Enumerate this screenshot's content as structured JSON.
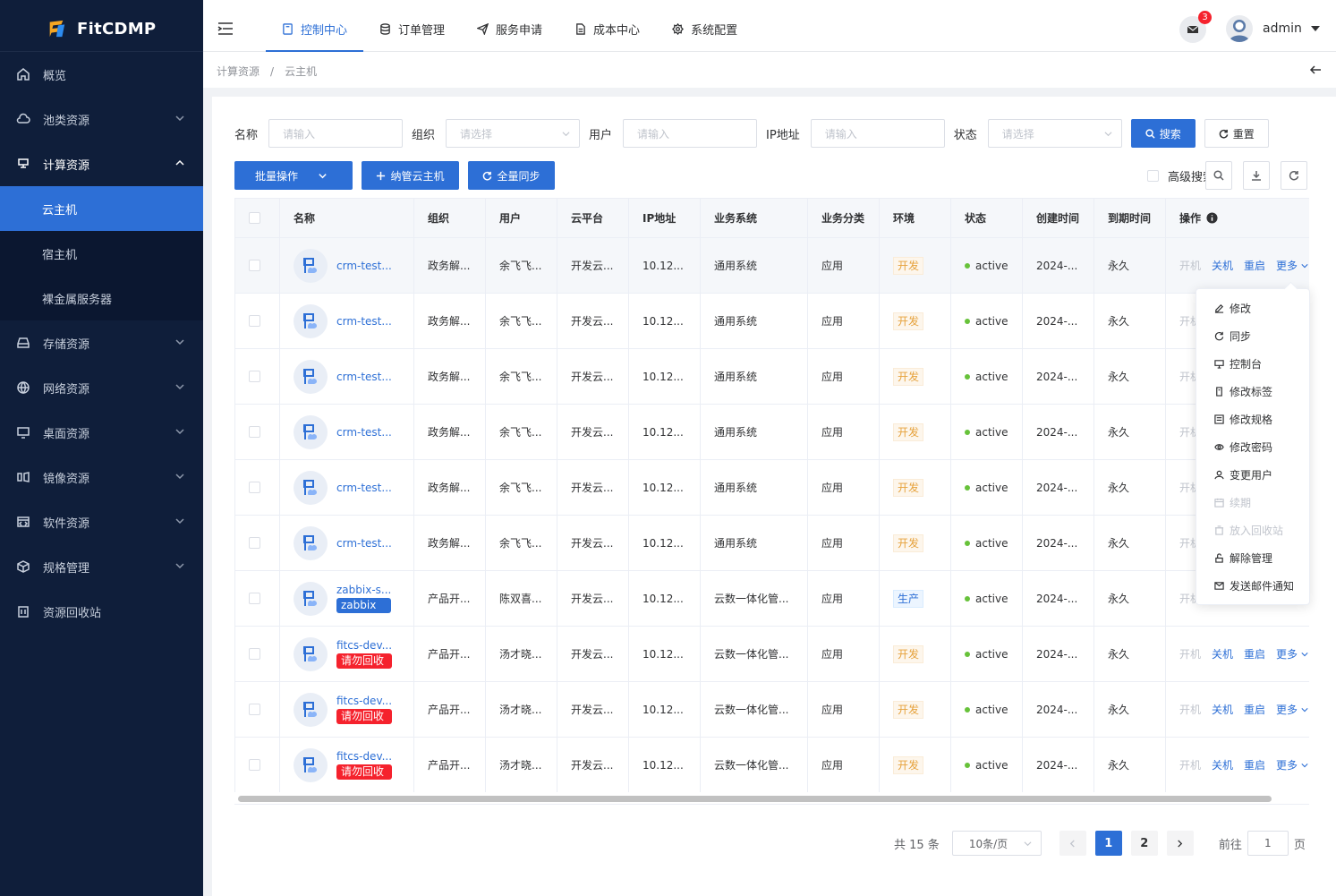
{
  "app": {
    "name": "FitCDMP"
  },
  "sidebar": {
    "items": [
      {
        "label": "概览",
        "icon": "home-icon"
      },
      {
        "label": "池类资源",
        "icon": "cloud-icon"
      },
      {
        "label": "计算资源",
        "icon": "compute-icon"
      },
      {
        "label": "存储资源",
        "icon": "storage-icon"
      },
      {
        "label": "网络资源",
        "icon": "globe-icon"
      },
      {
        "label": "桌面资源",
        "icon": "desktop-icon"
      },
      {
        "label": "镜像资源",
        "icon": "image-icon"
      },
      {
        "label": "软件资源",
        "icon": "software-icon"
      },
      {
        "label": "规格管理",
        "icon": "cube-icon"
      },
      {
        "label": "资源回收站",
        "icon": "trash-icon"
      }
    ],
    "sub_items": [
      "云主机",
      "宿主机",
      "裸金属服务器"
    ]
  },
  "topbar": {
    "tabs": [
      "控制中心",
      "订单管理",
      "服务申请",
      "成本中心",
      "系统配置"
    ],
    "badge_count": "3",
    "user": "admin"
  },
  "breadcrumb": {
    "parent": "计算资源",
    "sep": "/",
    "current": "云主机"
  },
  "filters": {
    "name_label": "名称",
    "name_placeholder": "请输入",
    "org_label": "组织",
    "org_placeholder": "请选择",
    "user_label": "用户",
    "user_placeholder": "请输入",
    "ip_label": "IP地址",
    "ip_placeholder": "请输入",
    "status_label": "状态",
    "status_placeholder": "请选择",
    "search": "搜索",
    "reset": "重置"
  },
  "actions": {
    "batch": "批量操作",
    "manage": "纳管云主机",
    "sync": "全量同步",
    "advanced": "高级搜索"
  },
  "table": {
    "headers": [
      "名称",
      "组织",
      "用户",
      "云平台",
      "IP地址",
      "业务系统",
      "业务分类",
      "环境",
      "状态",
      "创建时间",
      "到期时间",
      "操作"
    ],
    "rows": [
      {
        "name": "crm-test...",
        "tag": "",
        "org": "政务解...",
        "user": "余飞飞...",
        "cloud": "开发云...",
        "ip": "10.12...",
        "sys": "通用系统",
        "cat": "应用",
        "env": "开发",
        "status": "active",
        "created": "2024-...",
        "expire": "永久"
      },
      {
        "name": "crm-test...",
        "tag": "",
        "org": "政务解...",
        "user": "余飞飞...",
        "cloud": "开发云...",
        "ip": "10.12...",
        "sys": "通用系统",
        "cat": "应用",
        "env": "开发",
        "status": "active",
        "created": "2024-...",
        "expire": "永久"
      },
      {
        "name": "crm-test...",
        "tag": "",
        "org": "政务解...",
        "user": "余飞飞...",
        "cloud": "开发云...",
        "ip": "10.12...",
        "sys": "通用系统",
        "cat": "应用",
        "env": "开发",
        "status": "active",
        "created": "2024-...",
        "expire": "永久"
      },
      {
        "name": "crm-test...",
        "tag": "",
        "org": "政务解...",
        "user": "余飞飞...",
        "cloud": "开发云...",
        "ip": "10.12...",
        "sys": "通用系统",
        "cat": "应用",
        "env": "开发",
        "status": "active",
        "created": "2024-...",
        "expire": "永久"
      },
      {
        "name": "crm-test...",
        "tag": "",
        "org": "政务解...",
        "user": "余飞飞...",
        "cloud": "开发云...",
        "ip": "10.12...",
        "sys": "通用系统",
        "cat": "应用",
        "env": "开发",
        "status": "active",
        "created": "2024-...",
        "expire": "永久"
      },
      {
        "name": "crm-test...",
        "tag": "",
        "org": "政务解...",
        "user": "余飞飞...",
        "cloud": "开发云...",
        "ip": "10.12...",
        "sys": "通用系统",
        "cat": "应用",
        "env": "开发",
        "status": "active",
        "created": "2024-...",
        "expire": "永久"
      },
      {
        "name": "zabbix-s...",
        "tag": "zabbix",
        "tagType": "blue",
        "org": "产品开...",
        "user": "陈双喜...",
        "cloud": "开发云...",
        "ip": "10.12...",
        "sys": "云数一体化管...",
        "cat": "应用",
        "env": "生产",
        "status": "active",
        "created": "2024-...",
        "expire": "永久"
      },
      {
        "name": "fitcs-dev...",
        "tag": "请勿回收",
        "tagType": "red",
        "org": "产品开...",
        "user": "汤才晓...",
        "cloud": "开发云...",
        "ip": "10.12...",
        "sys": "云数一体化管...",
        "cat": "应用",
        "env": "开发",
        "status": "active",
        "created": "2024-...",
        "expire": "永久"
      },
      {
        "name": "fitcs-dev...",
        "tag": "请勿回收",
        "tagType": "red",
        "org": "产品开...",
        "user": "汤才晓...",
        "cloud": "开发云...",
        "ip": "10.12...",
        "sys": "云数一体化管...",
        "cat": "应用",
        "env": "开发",
        "status": "active",
        "created": "2024-...",
        "expire": "永久"
      },
      {
        "name": "fitcs-dev...",
        "tag": "请勿回收",
        "tagType": "red",
        "org": "产品开...",
        "user": "汤才晓...",
        "cloud": "开发云...",
        "ip": "10.12...",
        "sys": "云数一体化管...",
        "cat": "应用",
        "env": "开发",
        "status": "active",
        "created": "2024-...",
        "expire": "永久"
      }
    ],
    "ops": {
      "start": "开机",
      "stop": "关机",
      "restart": "重启",
      "more": "更多"
    }
  },
  "dropdown": {
    "items": [
      {
        "label": "修改",
        "icon": "edit-icon",
        "disabled": false
      },
      {
        "label": "同步",
        "icon": "sync-icon",
        "disabled": false
      },
      {
        "label": "控制台",
        "icon": "monitor-icon",
        "disabled": false
      },
      {
        "label": "修改标签",
        "icon": "tag-icon",
        "disabled": false
      },
      {
        "label": "修改规格",
        "icon": "spec-icon",
        "disabled": false
      },
      {
        "label": "修改密码",
        "icon": "eye-icon",
        "disabled": false
      },
      {
        "label": "变更用户",
        "icon": "user-icon",
        "disabled": false
      },
      {
        "label": "续期",
        "icon": "calendar-icon",
        "disabled": true
      },
      {
        "label": "放入回收站",
        "icon": "trash-icon",
        "disabled": true
      },
      {
        "label": "解除管理",
        "icon": "unlock-icon",
        "disabled": false
      },
      {
        "label": "发送邮件通知",
        "icon": "mail-icon",
        "disabled": false
      }
    ]
  },
  "pagination": {
    "total": "共 15 条",
    "page_size": "10条/页",
    "pages": [
      "1",
      "2"
    ],
    "current": "1",
    "goto": "前往",
    "goto_value": "1",
    "page_unit": "页"
  },
  "colors": {
    "primary": "#2d6fd6",
    "sidebar": "#0f1e3a",
    "danger": "#f5222d",
    "success": "#67c23a",
    "warning": "#e6a23c"
  }
}
